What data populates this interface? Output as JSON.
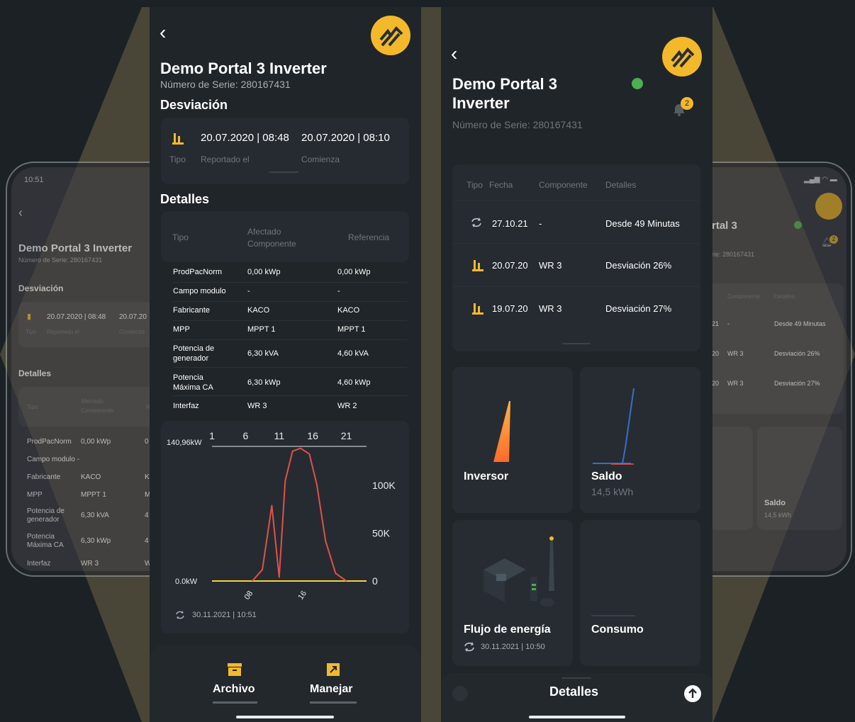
{
  "left_ghost": {
    "time": "10:51",
    "title": "Demo Portal 3 Inverter",
    "serial": "Número de Serie: 280167431",
    "section_dev": "Desviación",
    "dev_row": "20.07.2020 | 08:48",
    "dev_row2": "20.07.20",
    "dev_tipo": "Tipo",
    "dev_rep": "Reportado el",
    "dev_com": "Comienza",
    "section_det": "Detalles",
    "hdr_tipo": "Tipo",
    "hdr_af1": "Afectado",
    "hdr_af2": "Componente",
    "hdr_ref": "R",
    "rows": [
      {
        "k": "ProdPacNorm",
        "v": "0,00 kWp",
        "r": "0"
      },
      {
        "k": "Campo modulo -",
        "v": "",
        "r": ""
      },
      {
        "k": "Fabricante",
        "v": "KACO",
        "r": "K"
      },
      {
        "k": "MPP",
        "v": "MPPT 1",
        "r": "M"
      },
      {
        "k": "Potencia de",
        "k2": "generador",
        "v": "6,30 kVA",
        "r": "4"
      },
      {
        "k": "Potencia",
        "k2": "Máxima CA",
        "v": "6,30 kWp",
        "r": "4"
      },
      {
        "k": "Interfaz",
        "v": "WR 3",
        "r": "W"
      }
    ]
  },
  "right_ghost": {
    "title": "rtal 3",
    "serial": "rie: 280167431",
    "badge": "2",
    "hdr_comp": "Componente",
    "hdr_det": "Detalles",
    "rows": [
      {
        "a": "21",
        "b": "-",
        "c": "Desde 49 Minutas"
      },
      {
        "a": "20",
        "b": "WR 3",
        "c": "Desviación 26%"
      },
      {
        "a": "20",
        "b": "WR 3",
        "c": "Desviación 27%"
      }
    ],
    "tile_title": "Saldo",
    "tile_value": "14,5 kWh"
  },
  "phone1": {
    "title": "Demo Portal 3 Inverter",
    "serial": "Número de Serie: 280167431",
    "section_dev": "Desviación",
    "dev_date1": "20.07.2020 | 08:48",
    "dev_date2": "20.07.2020 | 08:10",
    "dev_tipo": "Tipo",
    "dev_rep": "Reportado el",
    "dev_com": "Comienza",
    "section_det": "Detalles",
    "hdr_tipo": "Tipo",
    "hdr_af1": "Afectado",
    "hdr_af2": "Componente",
    "hdr_ref": "Referencia",
    "rows": [
      {
        "k": "ProdPacNorm",
        "v": "0,00 kWp",
        "r": "0,00 kWp"
      },
      {
        "k": "Campo modulo",
        "v": "-",
        "r": "-"
      },
      {
        "k": "Fabricante",
        "v": "KACO",
        "r": "KACO"
      },
      {
        "k": "MPP",
        "v": "MPPT 1",
        "r": "MPPT 1"
      },
      {
        "k": "Potencia de",
        "k2": "generador",
        "v": "6,30 kVA",
        "r": "4,60 kVA"
      },
      {
        "k": "Potencia",
        "k2": "Máxima CA",
        "v": "6,30 kWp",
        "r": "4,60 kWp"
      },
      {
        "k": "Interfaz",
        "v": "WR 3",
        "r": "WR 2"
      }
    ],
    "chart_sync": "30.11.2021 | 10:51",
    "nav_archivo": "Archivo",
    "nav_manejar": "Manejar"
  },
  "phone2": {
    "title1": "Demo Portal 3",
    "title2": "Inverter",
    "serial": "Número de Serie: 280167431",
    "badge": "2",
    "hdr_tipo": "Tipo",
    "hdr_fecha": "Fecha",
    "hdr_comp": "Componente",
    "hdr_det": "Detalles",
    "events": [
      {
        "icon": "sync-icon",
        "date": "27.10.21",
        "comp": "-",
        "det": "Desde 49 Minutas"
      },
      {
        "icon": "solar-icon",
        "date": "20.07.20",
        "comp": "WR 3",
        "det": "Desviación 26%"
      },
      {
        "icon": "solar-icon",
        "date": "19.07.20",
        "comp": "WR 3",
        "det": "Desviación 27%"
      }
    ],
    "tiles": {
      "inversor": "Inversor",
      "saldo": "Saldo",
      "saldo_value": "14,5 kWh",
      "flujo": "Flujo de energía",
      "flujo_sync": "30.11.2021 | 10:50",
      "consumo": "Consumo"
    },
    "bottom": "Detalles"
  },
  "colors": {
    "accent": "#f4b92b",
    "line": "#e0514a",
    "status_green": "#4caf50",
    "orange": "#ff8a2b",
    "blue": "#3a6ec6"
  },
  "chart_data": {
    "type": "line",
    "x_ticks_top": [
      "1",
      "6",
      "11",
      "16",
      "21"
    ],
    "x_ticks_bottom": [
      "08",
      "16"
    ],
    "y_left_max_label": "140,96kW",
    "y_left_min_label": "0.0kW",
    "y_right_ticks": [
      "100K",
      "50K",
      "0"
    ],
    "xlim": [
      1,
      24
    ],
    "series": [
      {
        "x": [
          7.0,
          8.5,
          9.9,
          11.0,
          11.9,
          13.0,
          14.2,
          15.5,
          16.6,
          17.9,
          19.4,
          21.0
        ],
        "y": [
          0,
          12000,
          79000,
          4000,
          105000,
          136000,
          139000,
          133000,
          101000,
          42000,
          8000,
          0
        ]
      }
    ]
  }
}
